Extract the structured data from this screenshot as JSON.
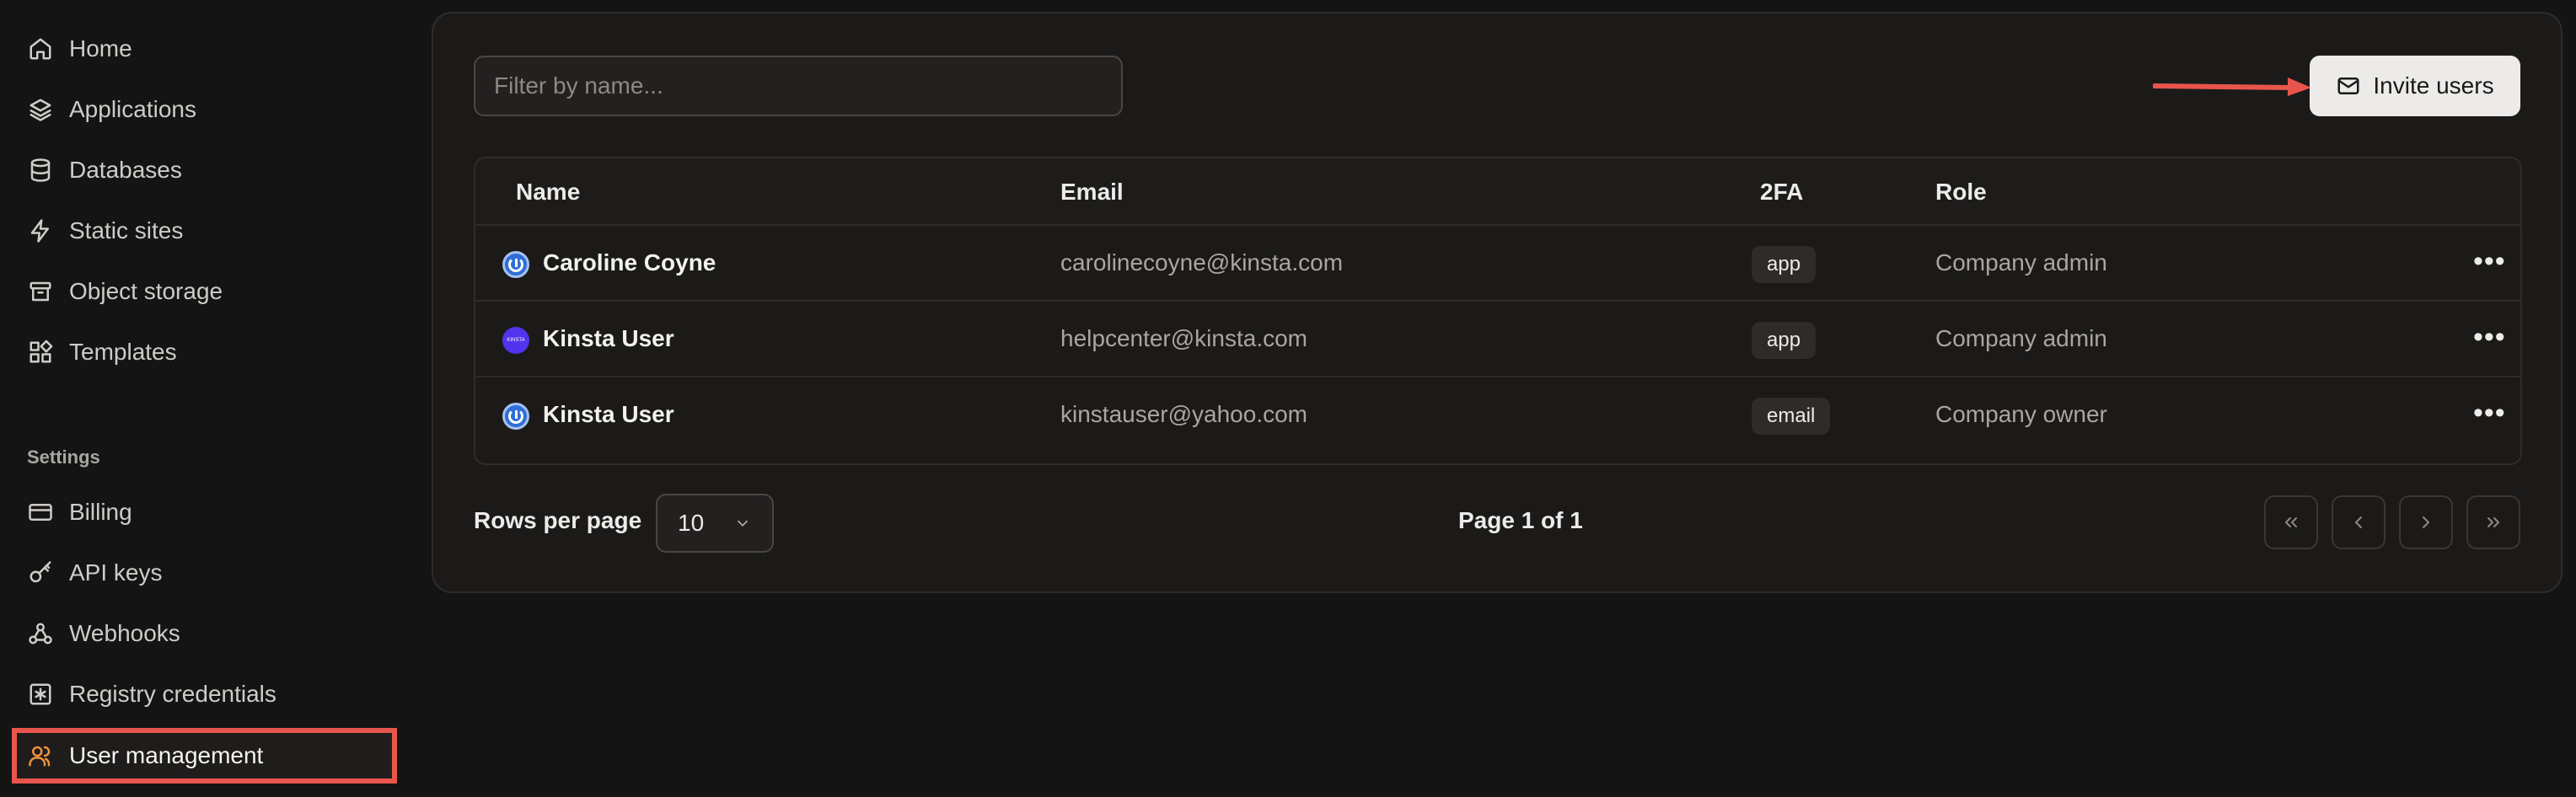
{
  "sidebar": {
    "items": [
      {
        "label": "Home",
        "icon": "home-icon"
      },
      {
        "label": "Applications",
        "icon": "layers-icon"
      },
      {
        "label": "Databases",
        "icon": "database-icon"
      },
      {
        "label": "Static sites",
        "icon": "bolt-icon"
      },
      {
        "label": "Object storage",
        "icon": "archive-icon"
      },
      {
        "label": "Templates",
        "icon": "templates-icon"
      }
    ],
    "settings_label": "Settings",
    "settings_items": [
      {
        "label": "Billing",
        "icon": "credit-card-icon"
      },
      {
        "label": "API keys",
        "icon": "key-icon"
      },
      {
        "label": "Webhooks",
        "icon": "webhook-icon"
      },
      {
        "label": "Registry credentials",
        "icon": "asterisk-square-icon"
      },
      {
        "label": "User management",
        "icon": "users-icon",
        "active": true
      }
    ]
  },
  "filter": {
    "placeholder": "Filter by name..."
  },
  "invite_button": {
    "label": "Invite users",
    "icon": "mail-icon"
  },
  "table": {
    "columns": [
      "Name",
      "Email",
      "2FA",
      "Role"
    ],
    "rows": [
      {
        "name": "Caroline Coyne",
        "email": "carolinecoyne@kinsta.com",
        "twofa": "app",
        "role": "Company admin",
        "avatar": "power-avatar"
      },
      {
        "name": "Kinsta User",
        "email": "helpcenter@kinsta.com",
        "twofa": "app",
        "role": "Company admin",
        "avatar": "kinsta-avatar",
        "avatar_text": "KINSTA"
      },
      {
        "name": "Kinsta User",
        "email": "kinstauser@yahoo.com",
        "twofa": "email",
        "role": "Company owner",
        "avatar": "power-avatar"
      }
    ]
  },
  "pagination": {
    "rows_per_page_label": "Rows per page",
    "rows_per_page_value": "10",
    "page_info": "Page 1 of 1"
  },
  "colors": {
    "accent": "#f0923a",
    "highlight": "#e8554c",
    "background": "#141414"
  }
}
